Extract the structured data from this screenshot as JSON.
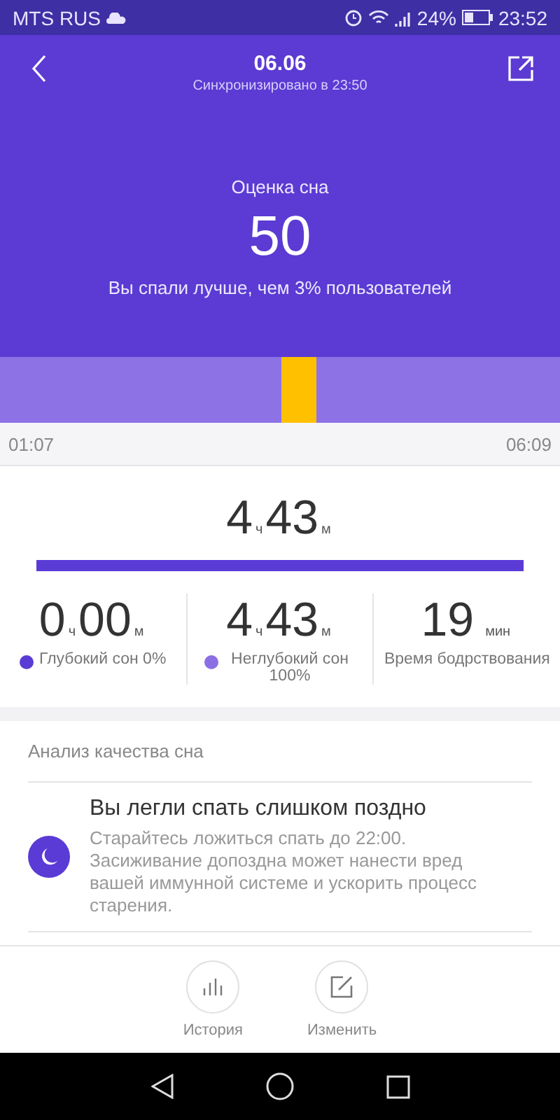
{
  "status_bar": {
    "carrier": "MTS RUS",
    "battery": "24%",
    "time": "23:52"
  },
  "header": {
    "title": "06.06",
    "subtitle": "Синхронизировано в 23:50"
  },
  "score": {
    "label": "Оценка сна",
    "value": "50",
    "comparison": "Вы спали лучше, чем 3% пользователей"
  },
  "timeline": {
    "start": "01:07",
    "end": "06:09"
  },
  "total": {
    "hours": "4",
    "hours_unit": "ч",
    "minutes": "43",
    "minutes_unit": "м"
  },
  "stats": [
    {
      "kind": "duration",
      "hours": "0",
      "hours_unit": "ч",
      "minutes": "00",
      "minutes_unit": "м",
      "label": "Глубокий сон 0%",
      "color": "#5a3bd6"
    },
    {
      "kind": "duration",
      "hours": "4",
      "hours_unit": "ч",
      "minutes": "43",
      "minutes_unit": "м",
      "label": "Неглубокий сон 100%",
      "color": "#8b6fe4"
    },
    {
      "kind": "count",
      "value": "19",
      "unit": "мин",
      "label": "Время бодрствования"
    }
  ],
  "analysis": {
    "title": "Анализ качества сна",
    "items": [
      {
        "heading": "Вы легли спать слишком поздно",
        "text": "Старайтесь ложиться спать до 22:00. Засиживание допоздна может нанести вред вашей иммунной системе и ускорить процесс старения."
      }
    ]
  },
  "actions": [
    {
      "kind": "history",
      "label": "История"
    },
    {
      "kind": "edit",
      "label": "Изменить"
    }
  ]
}
